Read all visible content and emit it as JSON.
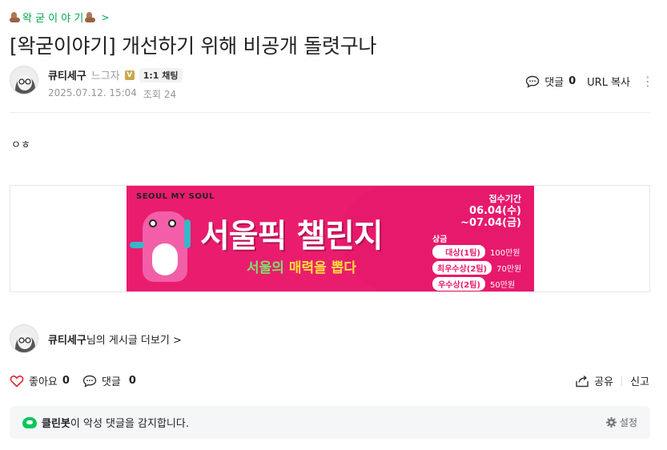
{
  "board": {
    "label": "왁 굳 이 야 기",
    "chevron": ">"
  },
  "post": {
    "title": "[왁굳이야기] 개선하기 위해 비공개 돌렷구나",
    "body": "ㅇㅎ",
    "date": "2025.07.12. 15:04",
    "views": "조회 24"
  },
  "author": {
    "nickname": "큐티세구",
    "level": "느그자",
    "level_badge": "V",
    "chat_label": "1:1 채팅"
  },
  "top_actions": {
    "comment_label": "댓글",
    "comment_count": "0",
    "url_copy": "URL 복사"
  },
  "banner": {
    "logo": "SEOUL MY SOUL",
    "headline": "서울픽 챌린지",
    "subline_a": "서울의 ",
    "subline_b": "매력",
    "subline_c": "을 뽑다",
    "period_label": "접수기간",
    "period": "06.04(수)\n~07.04(금)",
    "prize_label": "상금",
    "prizes": [
      {
        "tag": "대상(1팀)",
        "amount": "100만원"
      },
      {
        "tag": "최우수상(2팀)",
        "amount": "70만원"
      },
      {
        "tag": "우수상(2팀)",
        "amount": "50만원"
      }
    ]
  },
  "author_more": {
    "nickname": "큐티세구",
    "suffix": "님의 게시글 더보기",
    "chevron": ">"
  },
  "bottom_actions": {
    "like_label": "좋아요",
    "like_count": "0",
    "comment_label": "댓글",
    "comment_count": "0",
    "share": "공유",
    "report": "신고"
  },
  "cleanbot": {
    "name": "클린봇",
    "message": "이 악성 댓글을 감지합니다.",
    "settings": "설정"
  },
  "colors": {
    "accent": "#03a94e",
    "banner": "#ea1c6e",
    "like": "#e0242e"
  }
}
